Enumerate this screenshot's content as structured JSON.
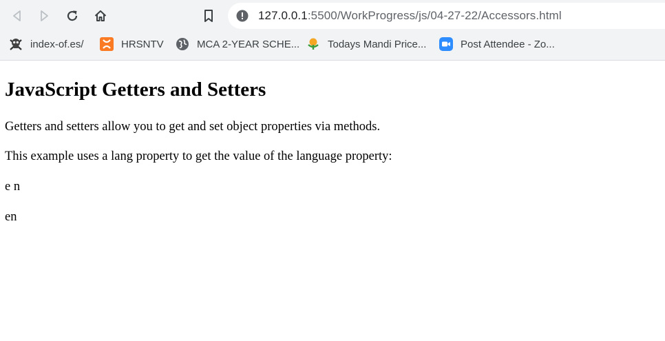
{
  "browser": {
    "url_host": "127.0.0.1",
    "url_path": ":5500/WorkProgress/js/04-27-22/Accessors.html",
    "bookmarks": [
      {
        "label": "index-of.es/",
        "icon": "skull-icon"
      },
      {
        "label": "HRSNTV",
        "icon": "xampp-icon"
      },
      {
        "label": "MCA 2-YEAR SCHE...",
        "icon": "globe-icon"
      },
      {
        "label": "Todays Mandi Price...",
        "icon": "mandi-icon"
      },
      {
        "label": "Post Attendee - Zo...",
        "icon": "zoom-icon"
      }
    ]
  },
  "page": {
    "heading": "JavaScript Getters and Setters",
    "intro": "Getters and setters allow you to get and set object properties via methods.",
    "example_text": "This example uses a lang property to get the value of the language property:",
    "demo1": "e n",
    "demo2": "en"
  }
}
